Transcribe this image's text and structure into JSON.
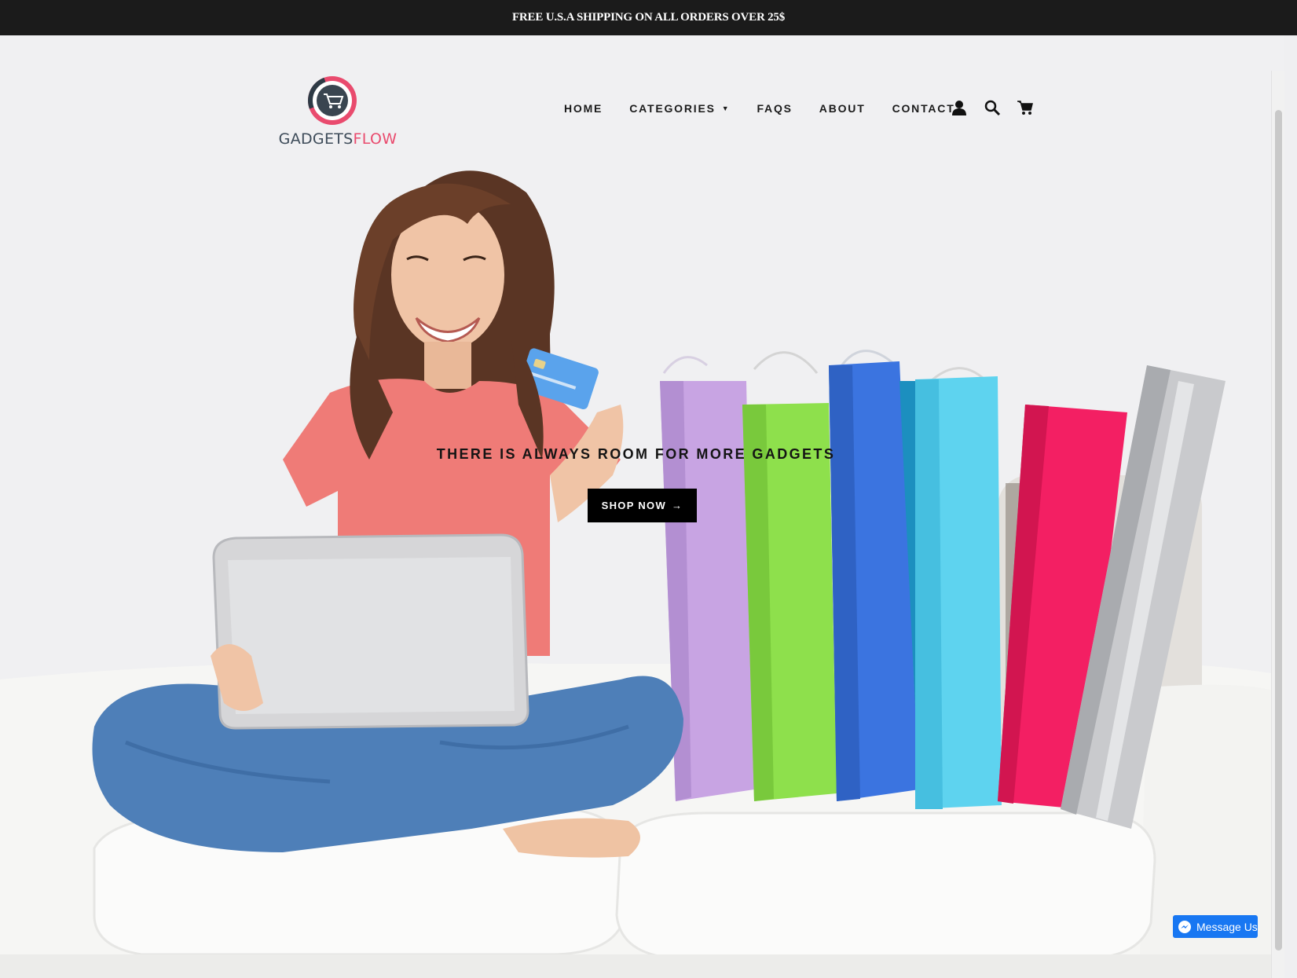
{
  "announcement": {
    "text": "FREE U.S.A SHIPPING ON ALL ORDERS OVER 25$"
  },
  "brand": {
    "name_part1": "GADGETS",
    "name_part2": "FLOW",
    "colors": {
      "dark": "#3d4b59",
      "accent": "#e94b6e"
    }
  },
  "nav": {
    "items": [
      {
        "label": "HOME"
      },
      {
        "label": "CATEGORIES",
        "has_dropdown": true
      },
      {
        "label": "FAQS"
      },
      {
        "label": "ABOUT"
      },
      {
        "label": "CONTACT"
      }
    ],
    "icons": [
      "account-icon",
      "search-icon",
      "cart-icon"
    ]
  },
  "hero": {
    "tagline": "THERE IS ALWAYS ROOM FOR MORE GADGETS",
    "cta_label": "SHOP NOW",
    "cta_arrow": "→"
  },
  "messenger": {
    "label": "Message Us",
    "color": "#1877f2"
  }
}
